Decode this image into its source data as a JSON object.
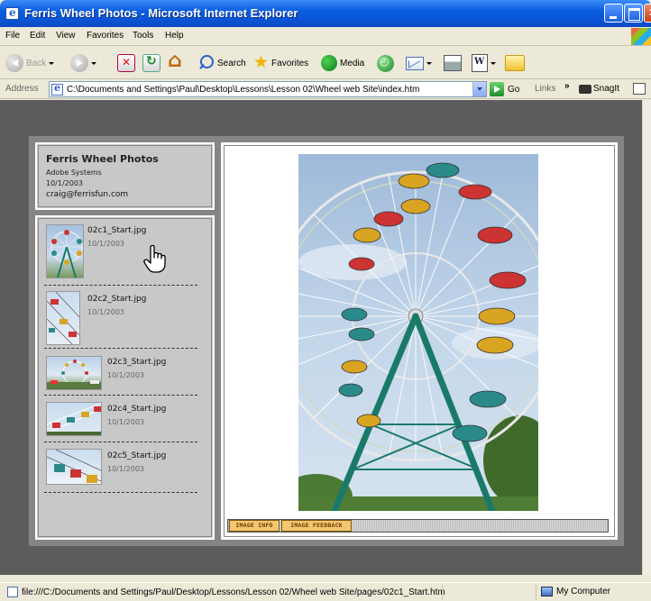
{
  "window": {
    "title": "Ferris Wheel Photos - Microsoft Internet Explorer"
  },
  "menu": [
    "File",
    "Edit",
    "View",
    "Favorites",
    "Tools",
    "Help"
  ],
  "toolbar": {
    "back": "Back",
    "search": "Search",
    "favorites": "Favorites",
    "media": "Media"
  },
  "address": {
    "label": "Address",
    "value": "C:\\Documents and Settings\\Paul\\Desktop\\Lessons\\Lesson 02\\Wheel web Site\\index.htm",
    "go": "Go",
    "links": "Links",
    "chevron": "»",
    "snagit": "SnagIt"
  },
  "gallery": {
    "title": "Ferris Wheel Photos",
    "company": "Adobe Systems",
    "date": "10/1/2003",
    "email": "craig@ferrisfun.com",
    "thumbs": [
      {
        "name": "02c1_Start.jpg",
        "date": "10/1/2003"
      },
      {
        "name": "02c2_Start.jpg",
        "date": "10/1/2003"
      },
      {
        "name": "02c3_Start.jpg",
        "date": "10/1/2003"
      },
      {
        "name": "02c4_Start.jpg",
        "date": "10/1/2003"
      },
      {
        "name": "02c5_Start.jpg",
        "date": "10/1/2003"
      }
    ],
    "tabs": {
      "info": "IMAGE INFO",
      "feedback": "IMAGE FEEDBACK"
    }
  },
  "status": {
    "message": "file:///C:/Documents and Settings/Paul/Desktop/Lessons/Lesson 02/Wheel web Site/pages/02c1_Start.htm",
    "zone": "My Computer"
  }
}
